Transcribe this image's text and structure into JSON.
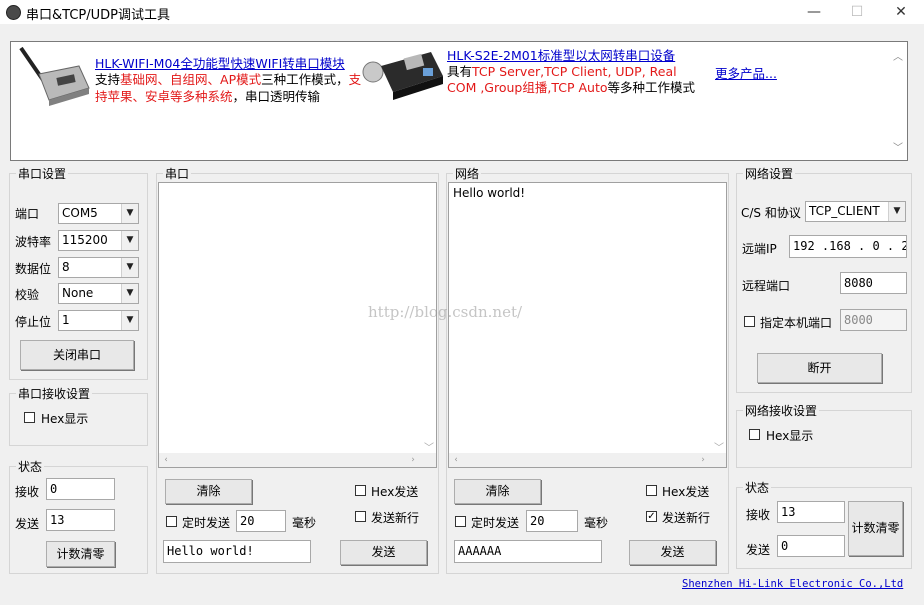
{
  "window": {
    "title": "串口&TCP/UDP调试工具",
    "minimize": "—",
    "maximize": "☐",
    "close": "✕"
  },
  "banner": {
    "ad1_title": "HLK-WIFI-M04全功能型快速WIFI转串口模块",
    "ad1_l2_a": "支持",
    "ad1_l2_b": "基础网、自组网、AP模式",
    "ad1_l2_c": "三种工作模式，",
    "ad1_l2_d": "支",
    "ad1_l3_a": "持苹果、安卓等多种系统",
    "ad1_l3_b": "，串口透明传输",
    "ad2_title": "HLK-S2E-2M01标准型以太网转串口设备",
    "ad2_l2_a": "具有",
    "ad2_l2_b": "TCP Server,TCP Client, UDP, Real",
    "ad2_l3_a": "COM ,Group组播,TCP Auto",
    "ad2_l3_b": "等多种工作模式",
    "more": "更多产品..."
  },
  "serial_settings": {
    "title": "串口设置",
    "port_label": "端口",
    "port_value": "COM5",
    "baud_label": "波特率",
    "baud_value": "115200",
    "databits_label": "数据位",
    "databits_value": "8",
    "parity_label": "校验",
    "parity_value": "None",
    "stopbits_label": "停止位",
    "stopbits_value": "1",
    "close_button": "关闭串口"
  },
  "serial_recv_settings": {
    "title": "串口接收设置",
    "hex_display": "Hex显示"
  },
  "serial_status": {
    "title": "状态",
    "recv_label": "接收",
    "recv_value": "0",
    "send_label": "发送",
    "send_value": "13",
    "reset_button": "计数清零"
  },
  "serial_panel": {
    "title": "串口",
    "receive_text": "",
    "clear_button": "清除",
    "hex_send": "Hex发送",
    "timed_send": "定时发送",
    "interval": "20",
    "ms": "毫秒",
    "send_newline": "发送新行",
    "input_text": "Hello world!",
    "send_button": "发送"
  },
  "network_panel": {
    "title": "网络",
    "receive_text": "Hello world!",
    "clear_button": "清除",
    "hex_send": "Hex发送",
    "timed_send": "定时发送",
    "interval": "20",
    "ms": "毫秒",
    "send_newline": "发送新行",
    "send_newline_checked": true,
    "input_text": "AAAAAA",
    "send_button": "发送"
  },
  "network_settings": {
    "title": "网络设置",
    "protocol_label": "C/S 和协议",
    "protocol_value": "TCP_CLIENT",
    "remote_ip_label": "远端IP",
    "remote_ip_value": "192 .168 . 0  . 2",
    "remote_port_label": "远程端口",
    "remote_port_value": "8080",
    "local_port_label": "指定本机端口",
    "local_port_value": "8000",
    "disconnect_button": "断开"
  },
  "network_recv_settings": {
    "title": "网络接收设置",
    "hex_display": "Hex显示"
  },
  "network_status": {
    "title": "状态",
    "recv_label": "接收",
    "recv_value": "13",
    "send_label": "发送",
    "send_value": "0",
    "reset_button": "计数清零"
  },
  "watermark": "http://blog.csdn.net/",
  "footer_link": "Shenzhen Hi-Link Electronic Co.,Ltd"
}
